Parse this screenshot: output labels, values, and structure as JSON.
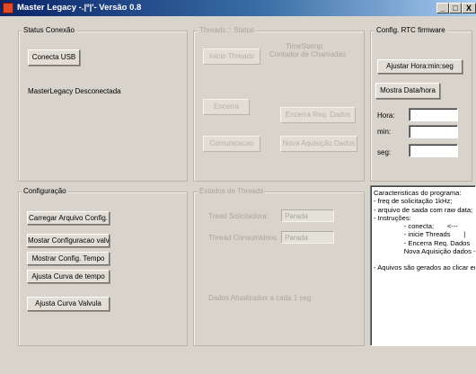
{
  "window": {
    "title": "Master Legacy -.|º|'- Versão 0.8",
    "controls": [
      "_",
      "□",
      "X"
    ]
  },
  "status": {
    "legend": "Status Conexão",
    "connect_button": "Conecta USB",
    "status_text": "MasterLegacy Desconectada"
  },
  "threads": {
    "legend": "Threads :: Status",
    "start_button": "Inicio Threads",
    "stop_button": "Encerra",
    "comm_button": "Comunicacao",
    "timestamp_label": "TimeStamp:",
    "counter_label": "Contador de Chamadas",
    "end_req_button": "Encerra Req. Dados",
    "new_acq_button": "Nova Aquisição Dados"
  },
  "rtc": {
    "legend": "Config. RTC firmware",
    "set_time_button": "Ajustar Hora:min:seg",
    "show_date_button": "Mostra Data/hora",
    "hour_label": "Hora:",
    "min_label": "min:",
    "sec_label": "seg:",
    "hour_value": "",
    "min_value": "",
    "sec_value": ""
  },
  "config": {
    "legend": "Configuração",
    "load_file_button": "Carregar Arquivo Config.",
    "show_valve_button": "Mostar Configuracao valv",
    "show_time_button": "Mostrar Config.  Tempo",
    "time_curve_button": "Ajusta Curva de tempo",
    "valve_curve_button": "Ajusta Curva Valvula"
  },
  "thread_states": {
    "legend": "Estados de Threads",
    "requested_label": "Tread Solicitadora:",
    "requested_value": "Parada",
    "consumer_label": "Thread Consumidora:",
    "consumer_value": "Parada",
    "updated_text": "Dados Atualizados  a cada 1 seg"
  },
  "info": {
    "lines": [
      "Caracteristicas do programa:",
      "- freq de solicitação 1kHz;",
      "- arquivo de saida com raw data;",
      "- Instruções:",
      "                - conecta;       <---",
      "                - inicie Threads       |",
      "                - Encerra Req. Dados   |",
      "                Nova Aquisição dados ---",
      "",
      "- Aquivos são gerados ao clicar em"
    ]
  }
}
